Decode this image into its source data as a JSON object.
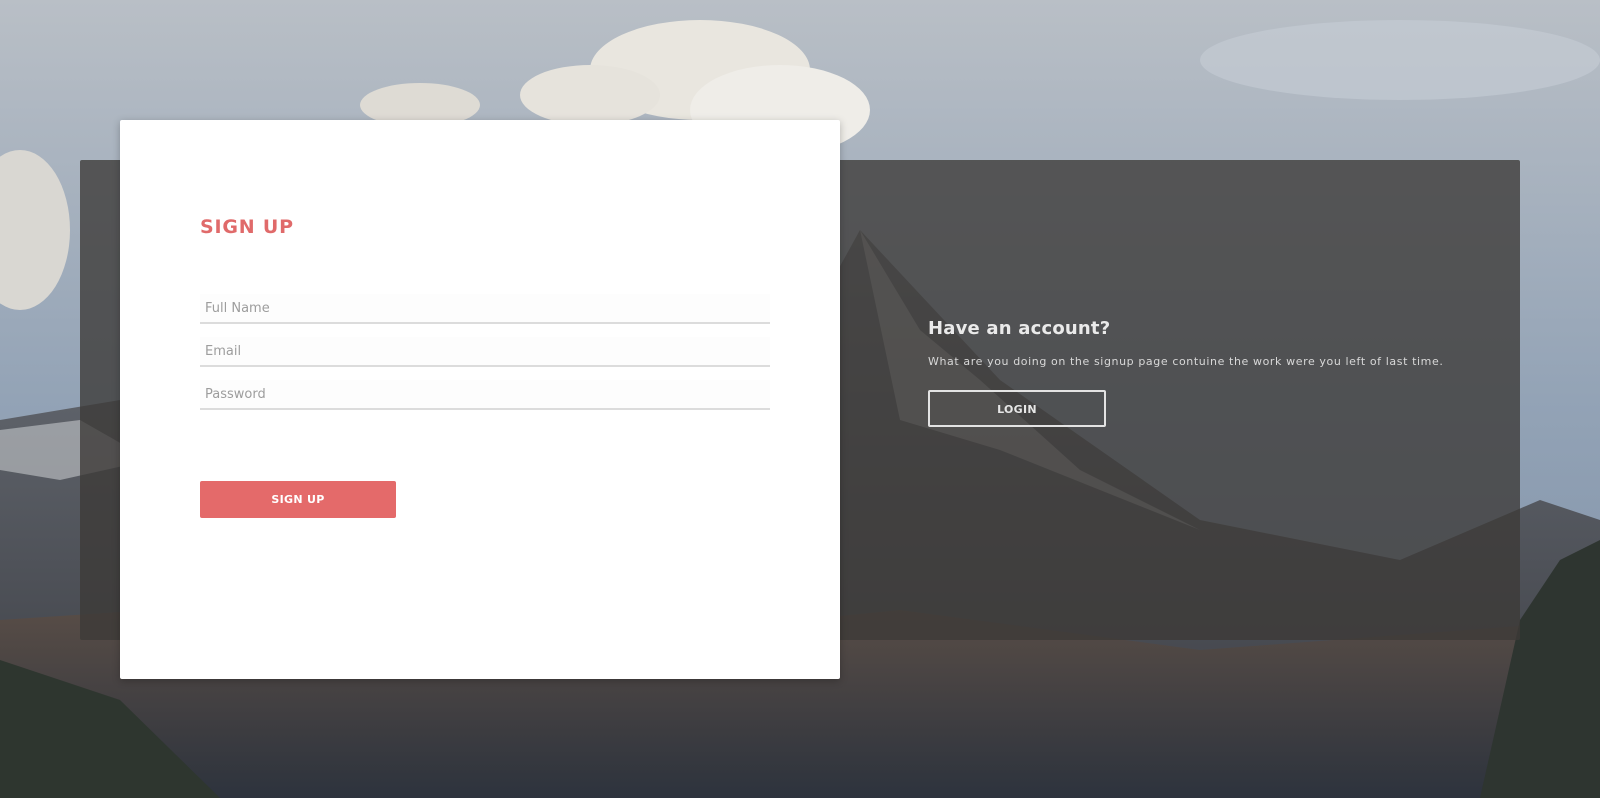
{
  "signup": {
    "title": "SIGN UP",
    "fields": [
      {
        "placeholder": "Full Name",
        "value": ""
      },
      {
        "placeholder": "Email",
        "value": ""
      },
      {
        "placeholder": "Password",
        "value": ""
      }
    ],
    "button_label": "SIGN UP",
    "accent_color": "#e46a6a"
  },
  "login_panel": {
    "title": "Have an account?",
    "message": "What are you doing on the signup page contuine the work were you left of last time.",
    "button_label": "LOGIN"
  }
}
